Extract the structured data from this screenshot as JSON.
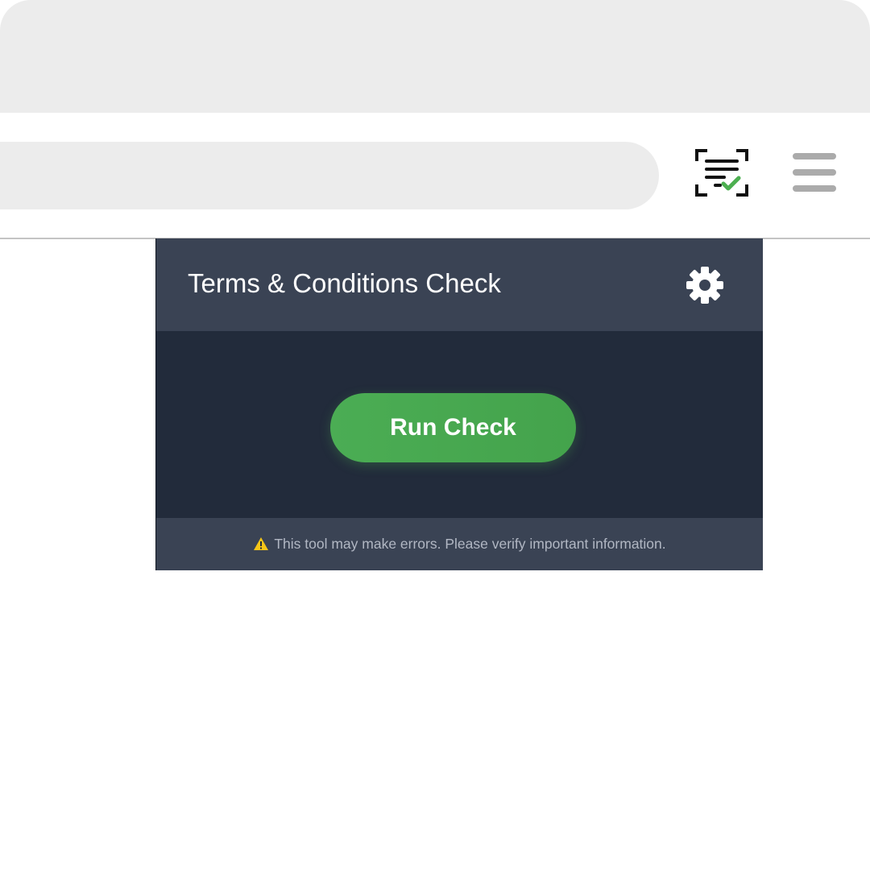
{
  "browser": {
    "extension_icon": "document-scan-check-icon",
    "menu_icon": "hamburger-menu-icon"
  },
  "popup": {
    "title": "Terms & Conditions Check",
    "settings_icon": "gear-icon",
    "run_button_label": "Run Check",
    "footer_icon": "warning-icon",
    "footer_text": "This tool may make errors. Please verify important information."
  },
  "colors": {
    "accent_green": "#4caf50",
    "header_slate": "#3a4354",
    "body_dark": "#222b3b",
    "warning_yellow": "#f5c518"
  }
}
